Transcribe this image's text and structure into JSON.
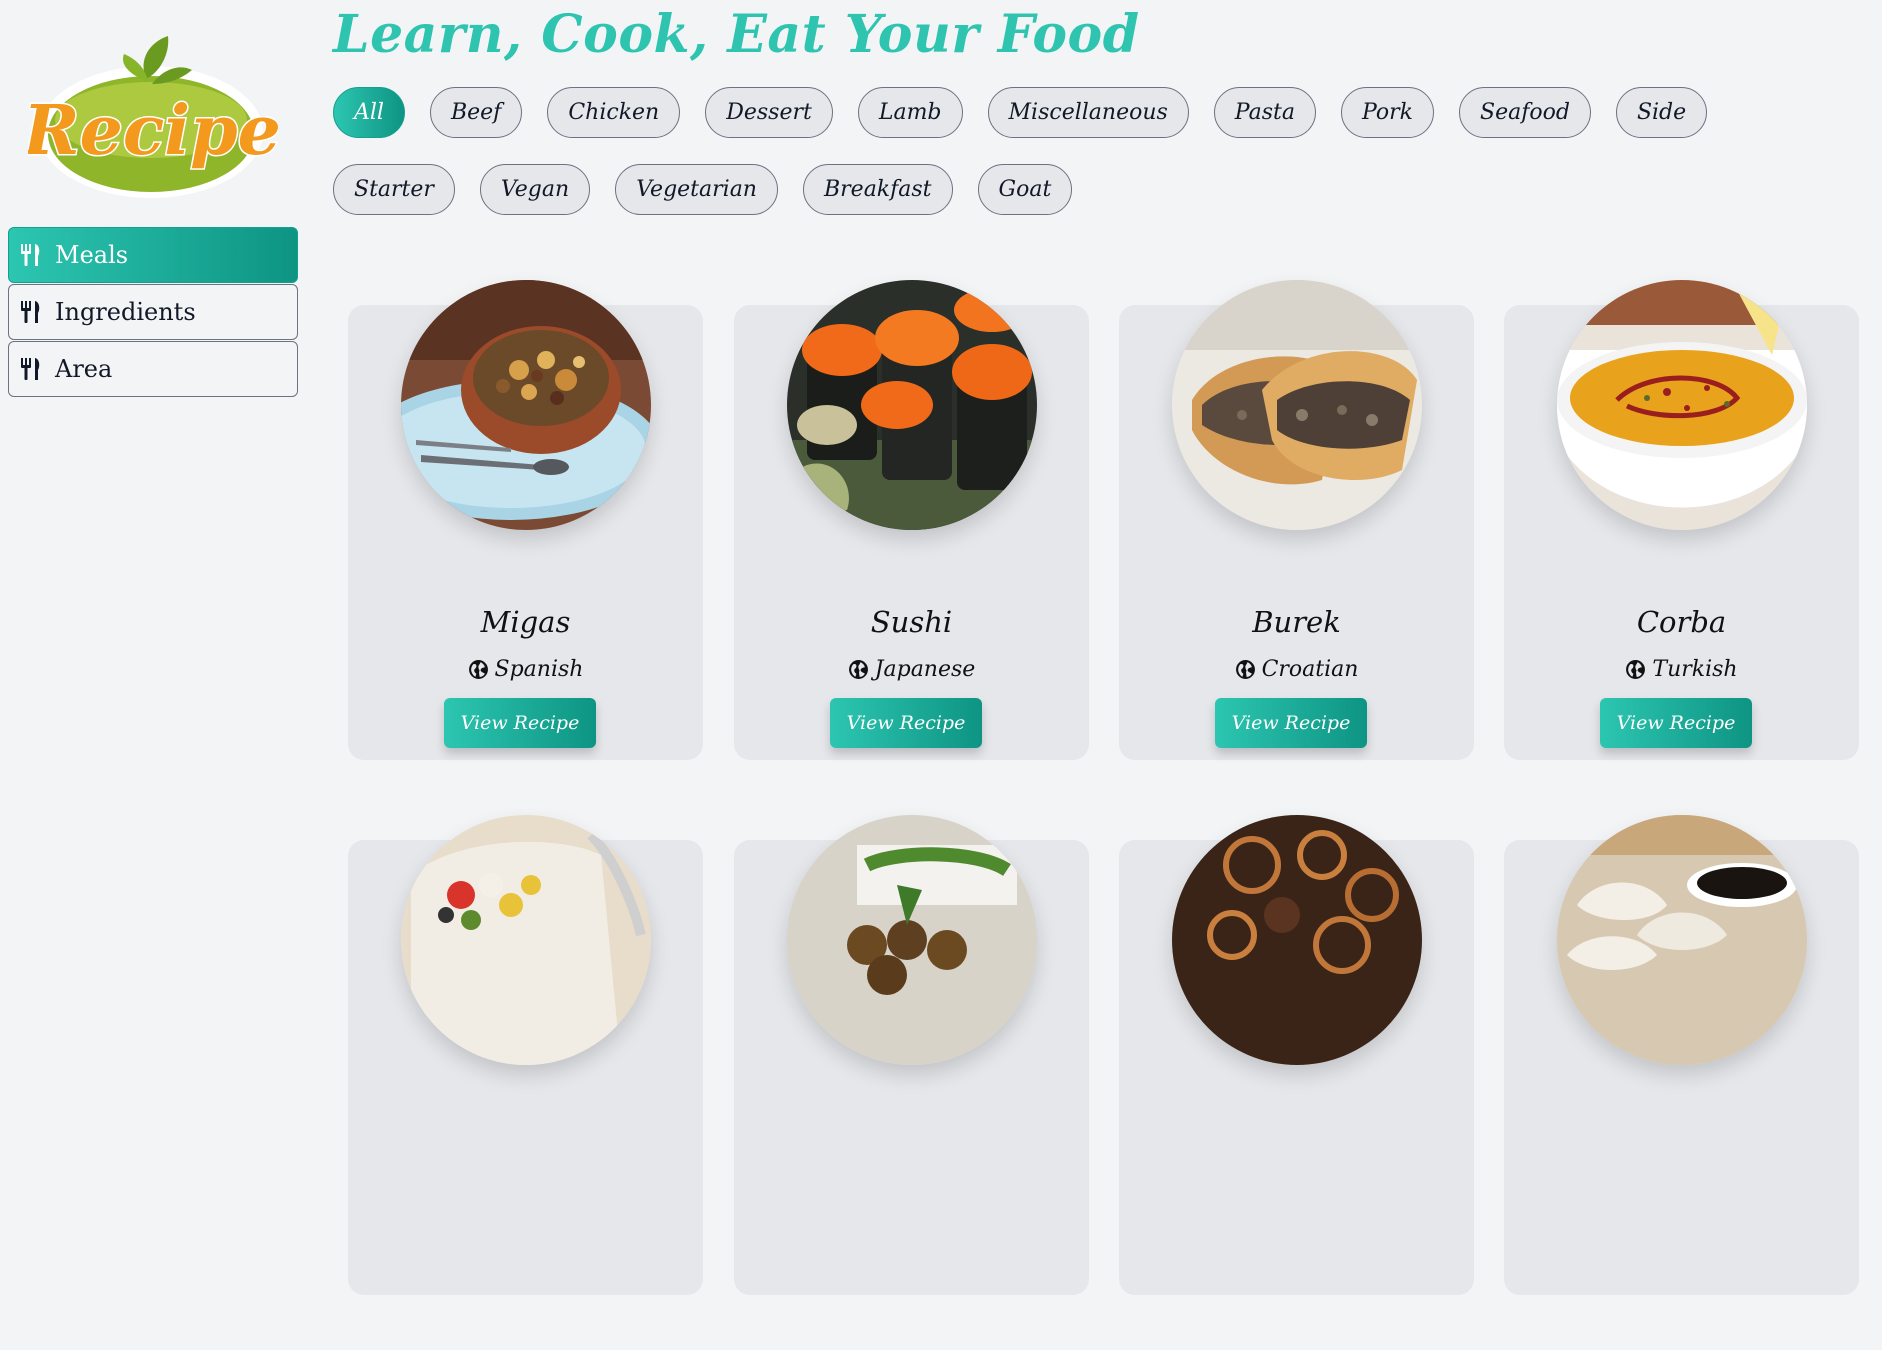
{
  "logo": {
    "text": "Recipe"
  },
  "nav": {
    "items": [
      {
        "label": "Meals",
        "icon": "utensils-icon",
        "active": true
      },
      {
        "label": "Ingredients",
        "icon": "utensils-icon",
        "active": false
      },
      {
        "label": "Area",
        "icon": "utensils-icon",
        "active": false
      }
    ]
  },
  "header": {
    "title": "Learn, Cook, Eat Your Food"
  },
  "filters": [
    "All",
    "Beef",
    "Chicken",
    "Dessert",
    "Lamb",
    "Miscellaneous",
    "Pasta",
    "Pork",
    "Seafood",
    "Side",
    "Starter",
    "Vegan",
    "Vegetarian",
    "Breakfast",
    "Goat"
  ],
  "active_filter": "All",
  "meals": [
    {
      "name": "Migas",
      "area": "Spanish",
      "button": "View Recipe"
    },
    {
      "name": "Sushi",
      "area": "Japanese",
      "button": "View Recipe"
    },
    {
      "name": "Burek",
      "area": "Croatian",
      "button": "View Recipe"
    },
    {
      "name": "Corba",
      "area": "Turkish",
      "button": "View Recipe"
    },
    {
      "name": "",
      "area": "",
      "button": ""
    },
    {
      "name": "",
      "area": "",
      "button": ""
    },
    {
      "name": "",
      "area": "",
      "button": ""
    },
    {
      "name": "",
      "area": "",
      "button": ""
    }
  ],
  "colors": {
    "accent": "#2ec4b0",
    "accent_dark": "#0e9483",
    "background": "#f3f4f6",
    "card": "#e5e7eb",
    "logo_orange": "#f39a1e",
    "logo_green": "#8fb52b"
  }
}
